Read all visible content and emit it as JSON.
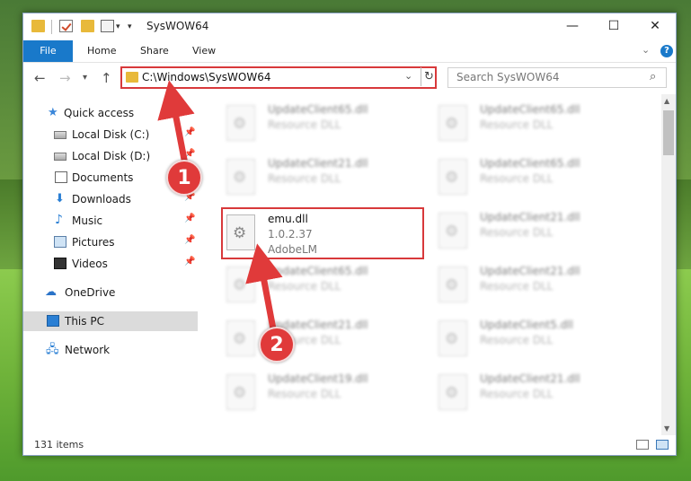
{
  "window": {
    "title": "SysWOW64",
    "controls": {
      "minimize": "—",
      "maximize": "☐",
      "close": "✕"
    }
  },
  "ribbon": {
    "tabs": [
      "File",
      "Home",
      "Share",
      "View"
    ],
    "help": "?"
  },
  "nav": {
    "address": "C:\\Windows\\SysWOW64",
    "search_placeholder": "Search SysWOW64"
  },
  "sidebar": {
    "items": [
      {
        "label": "Quick access",
        "icon": "star-icon",
        "pinned": false
      },
      {
        "label": "Local Disk (C:)",
        "icon": "drive-icon",
        "pinned": true
      },
      {
        "label": "Local Disk (D:)",
        "icon": "drive-icon",
        "pinned": true
      },
      {
        "label": "Documents",
        "icon": "documents-icon",
        "pinned": true
      },
      {
        "label": "Downloads",
        "icon": "download-icon",
        "pinned": true
      },
      {
        "label": "Music",
        "icon": "music-icon",
        "pinned": true
      },
      {
        "label": "Pictures",
        "icon": "pictures-icon",
        "pinned": true
      },
      {
        "label": "Videos",
        "icon": "videos-icon",
        "pinned": true
      },
      {
        "label": "OneDrive",
        "icon": "cloud-icon",
        "pinned": false
      },
      {
        "label": "This PC",
        "icon": "computer-icon",
        "pinned": false,
        "selected": true
      },
      {
        "label": "Network",
        "icon": "network-icon",
        "pinned": false
      }
    ]
  },
  "files": {
    "left": [
      {
        "name": "UpdateClient65.dll",
        "sub1": "Resource DLL",
        "sub2": ""
      },
      {
        "name": "UpdateClient21.dll",
        "sub1": "Resource DLL",
        "sub2": ""
      },
      {
        "name": "emu.dll",
        "sub1": "1.0.2.37",
        "sub2": "AdobeLM",
        "highlighted": true
      },
      {
        "name": "UpdateClient65.dll",
        "sub1": "Resource DLL",
        "sub2": ""
      },
      {
        "name": "UpdateClient21.dll",
        "sub1": "Resource DLL",
        "sub2": ""
      },
      {
        "name": "UpdateClient19.dll",
        "sub1": "Resource DLL",
        "sub2": ""
      }
    ],
    "right": [
      {
        "name": "UpdateClient65.dll",
        "sub1": "Resource DLL"
      },
      {
        "name": "UpdateClient65.dll",
        "sub1": "Resource DLL"
      },
      {
        "name": "UpdateClient21.dll",
        "sub1": "Resource DLL"
      },
      {
        "name": "UpdateClient21.dll",
        "sub1": "Resource DLL"
      },
      {
        "name": "UpdateClient5.dll",
        "sub1": "Resource DLL"
      },
      {
        "name": "UpdateClient21.dll",
        "sub1": "Resource DLL"
      }
    ]
  },
  "status": {
    "item_count": "131 items"
  },
  "annotations": {
    "step1": "1",
    "step2": "2"
  },
  "colors": {
    "accent": "#1979ca",
    "highlight": "#d8393b",
    "folder": "#e8b93a"
  }
}
